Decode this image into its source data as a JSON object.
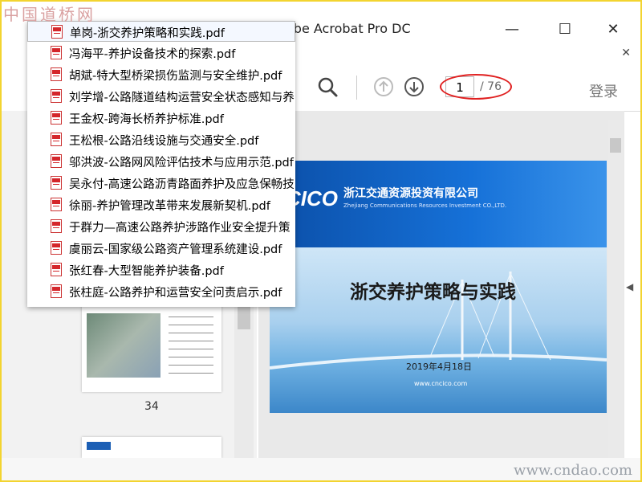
{
  "window": {
    "title": "obe Acrobat Pro DC",
    "minimize": "—",
    "maximize": "☐",
    "close": "✕",
    "tab_close": "✕"
  },
  "toolbar": {
    "page_current": "1",
    "page_total": "/ 76",
    "login": "登录"
  },
  "thumbnails": {
    "page_label": "34"
  },
  "popup": {
    "files": [
      "单岗-浙交养护策略和实践.pdf",
      "冯海平-养护设备技术的探索.pdf",
      "胡斌-特大型桥梁损伤监测与安全维护.pdf",
      "刘学增-公路隧道结构运营安全状态感知与养",
      "王金权-跨海长桥养护标准.pdf",
      "王松根-公路沿线设施与交通安全.pdf",
      "邬洪波-公路网风险评估技术与应用示范.pdf",
      "吴永付-高速公路沥青路面养护及应急保畅技",
      "徐丽-养护管理改革带来发展新契机.pdf",
      "于群力—高速公路养护涉路作业安全提升策",
      "虞丽云-国家级公路资产管理系统建设.pdf",
      "张红春-大型智能养护装备.pdf",
      "张柱庭-公路养护和运营安全问责启示.pdf"
    ]
  },
  "document": {
    "logo": "CICO",
    "company": "浙江交通资源投资有限公司",
    "company_en": "Zhejiang Communications Resources Investment CO.,LTD.",
    "title": "浙交养护策略与实践",
    "date": "2019年4月18日",
    "url": "www.cncico.com"
  },
  "watermark": {
    "top_left": "中国道桥网",
    "bottom_right": "www.cndao.com"
  },
  "colors": {
    "accent_blue": "#1671d8",
    "annotation_red": "#e02020",
    "frame_yellow": "#f3d430"
  }
}
